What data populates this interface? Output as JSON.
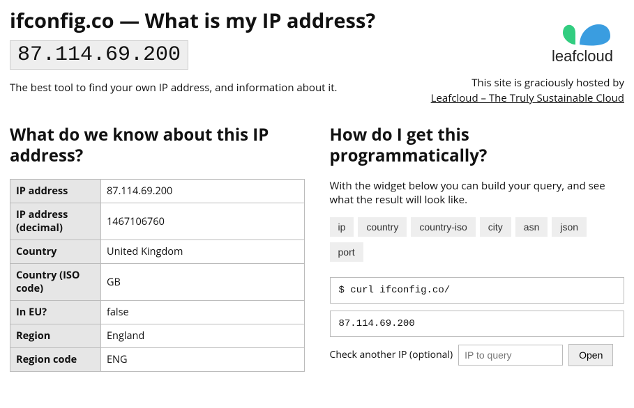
{
  "header": {
    "title": "ifconfig.co — What is my IP address?",
    "ip": "87.114.69.200",
    "tagline": "The best tool to find your own IP address, and information about it."
  },
  "sponsor": {
    "logo_word": "leafcloud",
    "intro": "This site is graciously hosted by",
    "link_text": "Leafcloud – The Truly Sustainable Cloud"
  },
  "info": {
    "heading": "What do we know about this IP address?",
    "rows": [
      {
        "k": "IP address",
        "v": "87.114.69.200"
      },
      {
        "k": "IP address (decimal)",
        "v": "1467106760"
      },
      {
        "k": "Country",
        "v": "United Kingdom"
      },
      {
        "k": "Country (ISO code)",
        "v": "GB"
      },
      {
        "k": "In EU?",
        "v": "false"
      },
      {
        "k": "Region",
        "v": "England"
      },
      {
        "k": "Region code",
        "v": "ENG"
      }
    ]
  },
  "api": {
    "heading": "How do I get this programmatically?",
    "intro": "With the widget below you can build your query, and see what the result will look like.",
    "chips": [
      "ip",
      "country",
      "country-iso",
      "city",
      "asn",
      "json",
      "port"
    ],
    "curl": "$ curl ifconfig.co/",
    "result": "87.114.69.200",
    "check_label": "Check another IP (optional)",
    "placeholder": "IP to query",
    "open_label": "Open"
  }
}
